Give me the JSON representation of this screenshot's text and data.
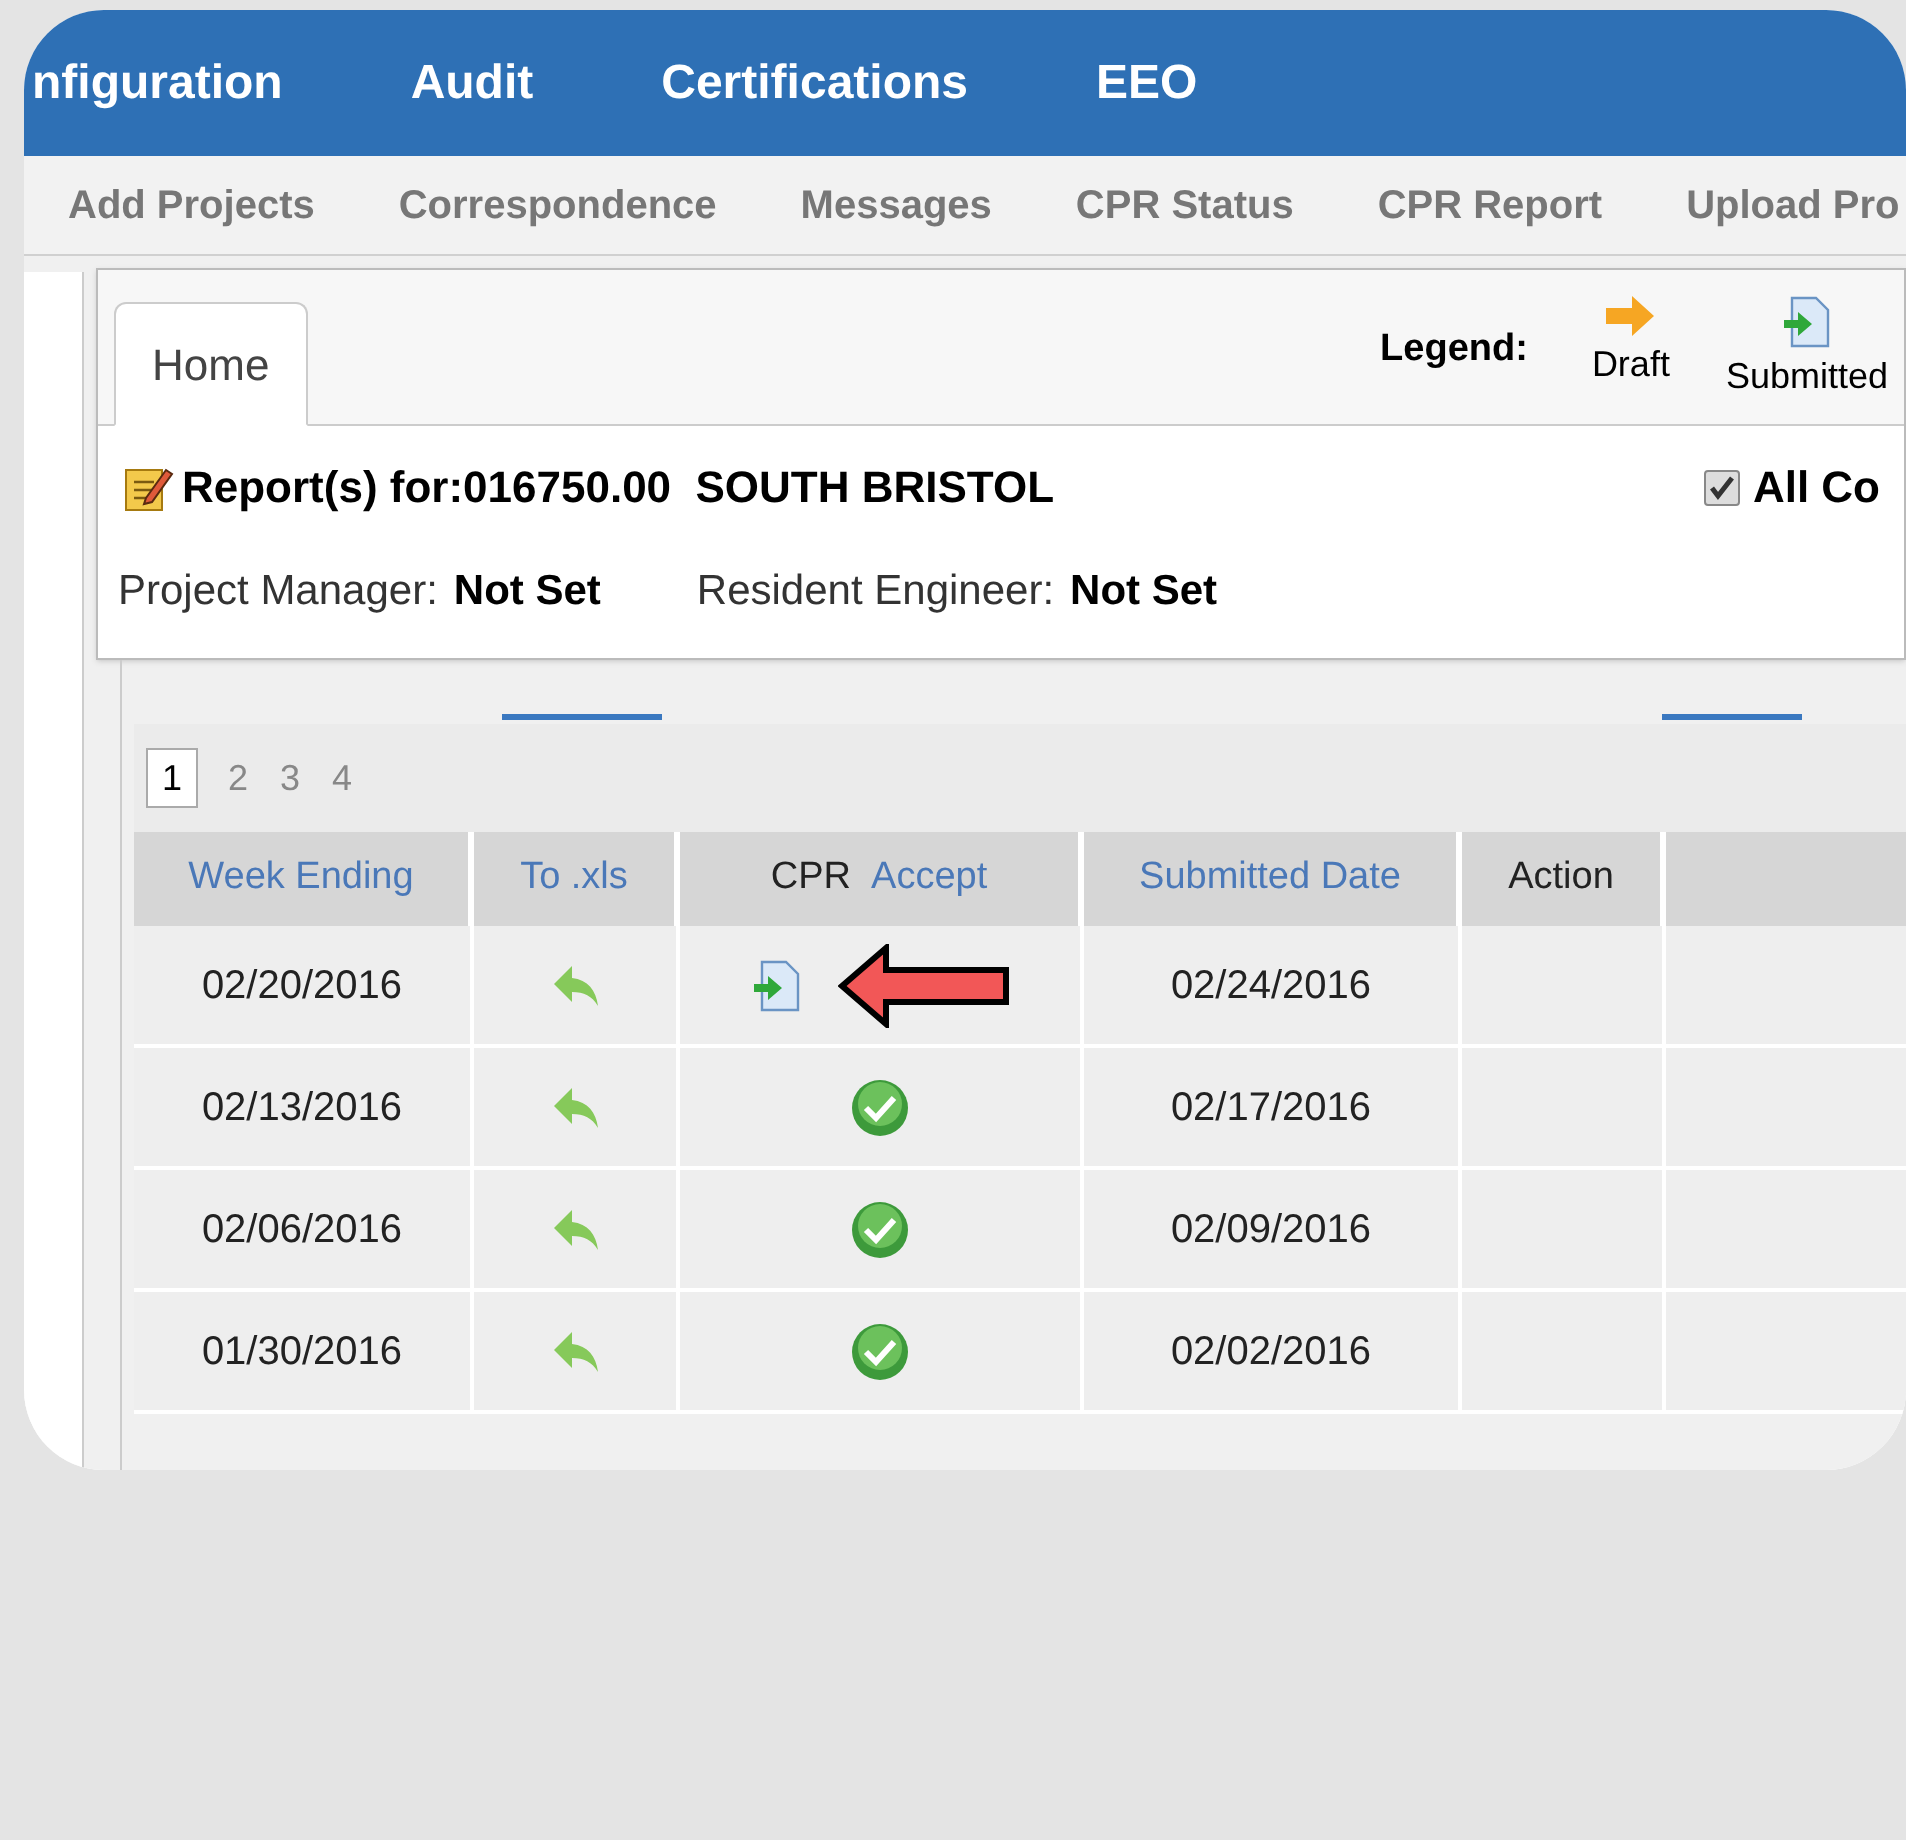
{
  "top_nav": [
    {
      "label": "nfiguration"
    },
    {
      "label": "Audit"
    },
    {
      "label": "Certifications"
    },
    {
      "label": "EEO"
    }
  ],
  "sub_nav": [
    {
      "label": "Add Projects"
    },
    {
      "label": "Correspondence"
    },
    {
      "label": "Messages"
    },
    {
      "label": "CPR Status"
    },
    {
      "label": "CPR Report"
    },
    {
      "label": "Upload Pro"
    }
  ],
  "tabs": [
    {
      "label": "Home",
      "selected": true
    }
  ],
  "legend": {
    "label": "Legend:",
    "items": [
      {
        "kind": "draft",
        "label": "Draft"
      },
      {
        "kind": "submitted",
        "label": "Submitted"
      }
    ]
  },
  "report": {
    "title": "Report(s) for:016750.00  SOUTH BRISTOL",
    "all_checkbox": {
      "label": "All Co",
      "checked": true
    }
  },
  "people": [
    {
      "label": "Project Manager:",
      "value": "Not Set"
    },
    {
      "label": "Resident Engineer:",
      "value": "Not Set"
    }
  ],
  "pager": [
    {
      "label": "1",
      "selected": true
    },
    {
      "label": "2",
      "selected": false
    },
    {
      "label": "3",
      "selected": false
    },
    {
      "label": "4",
      "selected": false
    }
  ],
  "table": {
    "columns": [
      {
        "parts": [
          {
            "text": "Week Ending",
            "link": true
          }
        ]
      },
      {
        "parts": [
          {
            "text": "To .xls",
            "link": true
          }
        ]
      },
      {
        "parts": [
          {
            "text": "CPR",
            "link": false
          },
          {
            "text": "Accept",
            "link": true
          }
        ]
      },
      {
        "parts": [
          {
            "text": "Submitted Date",
            "link": true
          }
        ]
      },
      {
        "parts": [
          {
            "text": "Action",
            "link": false
          }
        ]
      }
    ],
    "rows": [
      {
        "week_ending": "02/20/2016",
        "kind": "submitted",
        "submitted_date": "02/24/2016",
        "callout": true
      },
      {
        "week_ending": "02/13/2016",
        "kind": "accepted",
        "submitted_date": "02/17/2016",
        "callout": false
      },
      {
        "week_ending": "02/06/2016",
        "kind": "accepted",
        "submitted_date": "02/09/2016",
        "callout": false
      },
      {
        "week_ending": "01/30/2016",
        "kind": "accepted",
        "submitted_date": "02/02/2016",
        "callout": false
      }
    ]
  }
}
